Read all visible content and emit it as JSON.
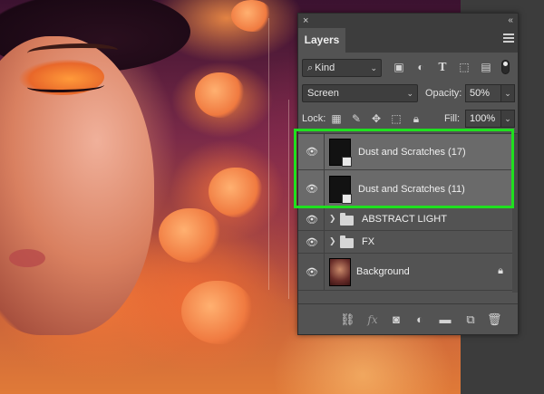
{
  "panel": {
    "close_glyph": "×",
    "collapse_glyph": "‹‹",
    "tab_label": "Layers",
    "filter": {
      "kind_label": "Kind",
      "toggle_on": true
    },
    "blend": {
      "mode": "Screen",
      "opacity_label": "Opacity:",
      "opacity_value": "50%"
    },
    "lock": {
      "label": "Lock:",
      "fill_label": "Fill:",
      "fill_value": "100%"
    },
    "layers": [
      {
        "name": "Dust and Scratches (17)",
        "type": "smart-object",
        "visible": true,
        "selected": true
      },
      {
        "name": "Dust and Scratches (11)",
        "type": "smart-object",
        "visible": true,
        "selected": true
      },
      {
        "name": "ABSTRACT LIGHT",
        "type": "group",
        "visible": true,
        "selected": false
      },
      {
        "name": "FX",
        "type": "group",
        "visible": true,
        "selected": false
      },
      {
        "name": "Background",
        "type": "image",
        "visible": true,
        "selected": false,
        "locked": true
      }
    ],
    "bottom_icons": [
      "link-icon",
      "fx-icon",
      "mask-icon",
      "adjustment-icon",
      "folder-icon",
      "new-layer-icon",
      "trash-icon"
    ]
  },
  "colors": {
    "highlight": "#1fe01f",
    "panel_bg": "#535353",
    "selected_row": "#6a6a6a"
  }
}
